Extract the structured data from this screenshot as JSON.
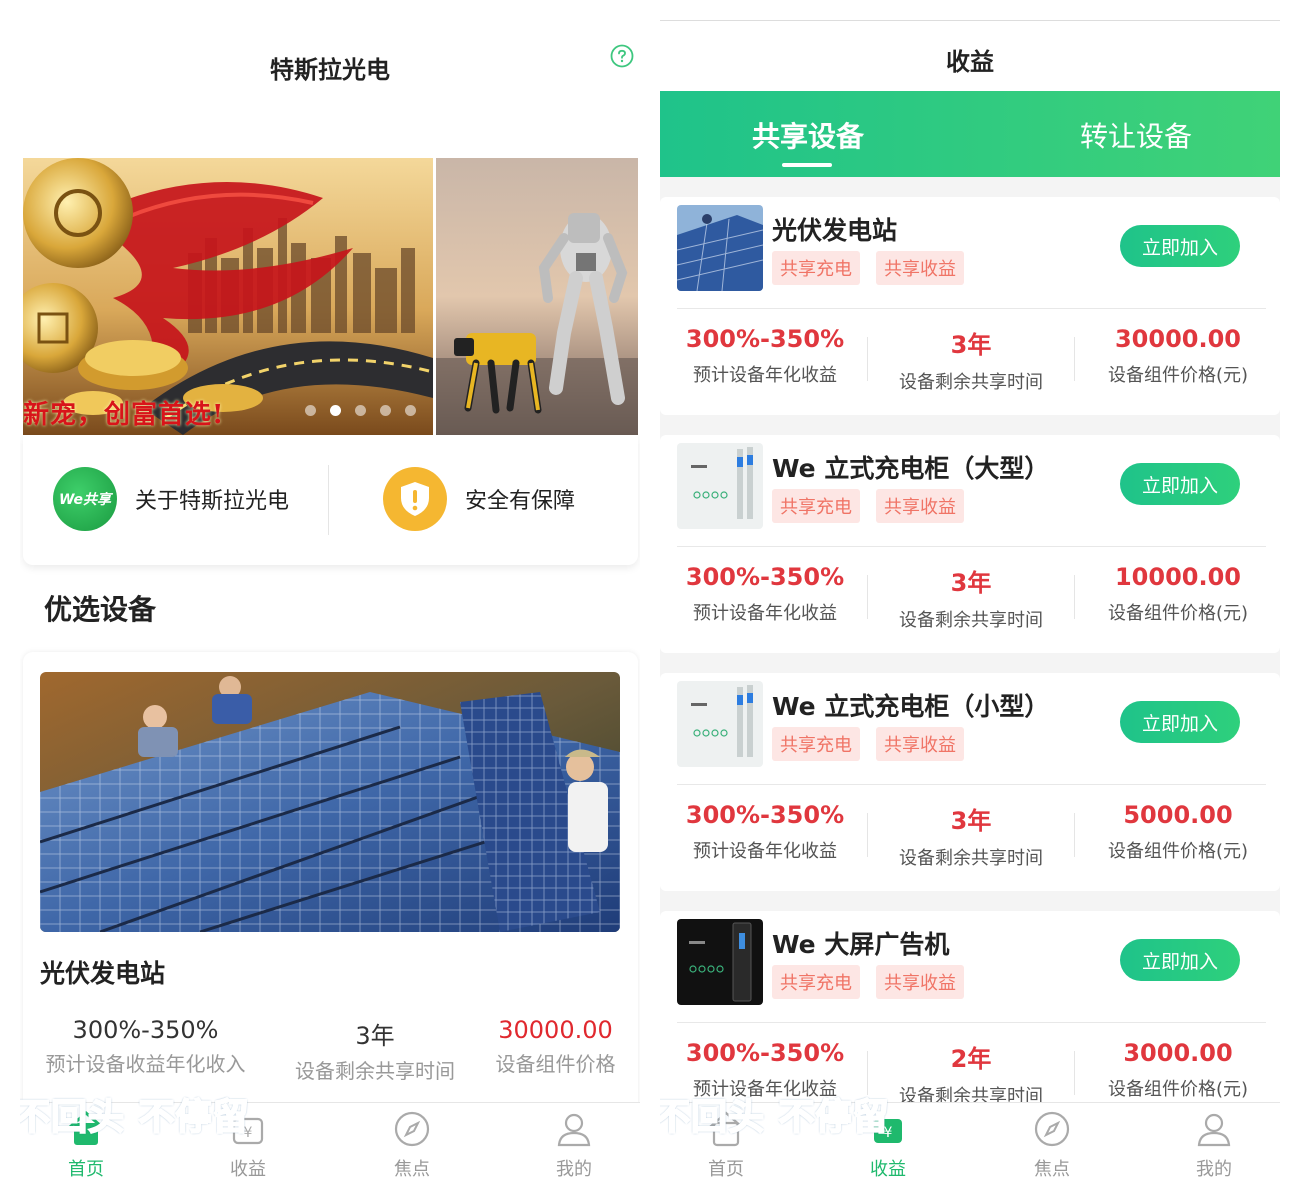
{
  "left": {
    "title": "特斯拉光电",
    "banner_text": "新宠，创富首选!",
    "info_items": [
      {
        "label": "关于特斯拉光电",
        "icon": "we-share-logo-icon",
        "badge": "We共享"
      },
      {
        "label": "安全有保障",
        "icon": "shield-icon"
      }
    ],
    "section_title": "优选设备",
    "featured": {
      "name": "光伏发电站",
      "stats": [
        {
          "value": "300%-350%",
          "label": "预计设备收益年化收入"
        },
        {
          "value": "3年",
          "label": "设备剩余共享时间"
        },
        {
          "value": "30000.00",
          "label": "设备组件价格"
        }
      ]
    },
    "overlay_text": "不回头 不停留"
  },
  "right": {
    "title": "收益",
    "tabs": [
      {
        "label": "共享设备",
        "active": true
      },
      {
        "label": "转让设备",
        "active": false
      }
    ],
    "join_label": "立即加入",
    "stat_labels": [
      "预计设备年化收益",
      "设备剩余共享时间",
      "设备组件价格(元)"
    ],
    "items": [
      {
        "name": "光伏发电站",
        "tags": [
          "共享充电",
          "共享收益"
        ],
        "rate": "300%-350%",
        "term": "3年",
        "price": "30000.00"
      },
      {
        "name": "We 立式充电柜（大型）",
        "tags": [
          "共享充电",
          "共享收益"
        ],
        "rate": "300%-350%",
        "term": "3年",
        "price": "10000.00"
      },
      {
        "name": "We 立式充电柜（小型）",
        "tags": [
          "共享充电",
          "共享收益"
        ],
        "rate": "300%-350%",
        "term": "3年",
        "price": "5000.00"
      },
      {
        "name": "We 大屏广告机",
        "tags": [
          "共享充电",
          "共享收益"
        ],
        "rate": "300%-350%",
        "term": "2年",
        "price": "3000.00"
      }
    ],
    "overlay_text": "不回头 不停留"
  },
  "nav": [
    {
      "label": "首页",
      "icon": "home-icon"
    },
    {
      "label": "收益",
      "icon": "wallet-icon"
    },
    {
      "label": "焦点",
      "icon": "compass-icon"
    },
    {
      "label": "我的",
      "icon": "user-icon"
    }
  ],
  "colors": {
    "brand_green": "#1fc38a",
    "price_red": "#e0282e",
    "tag_bg": "#fde6e4",
    "tag_text": "#f07466"
  }
}
